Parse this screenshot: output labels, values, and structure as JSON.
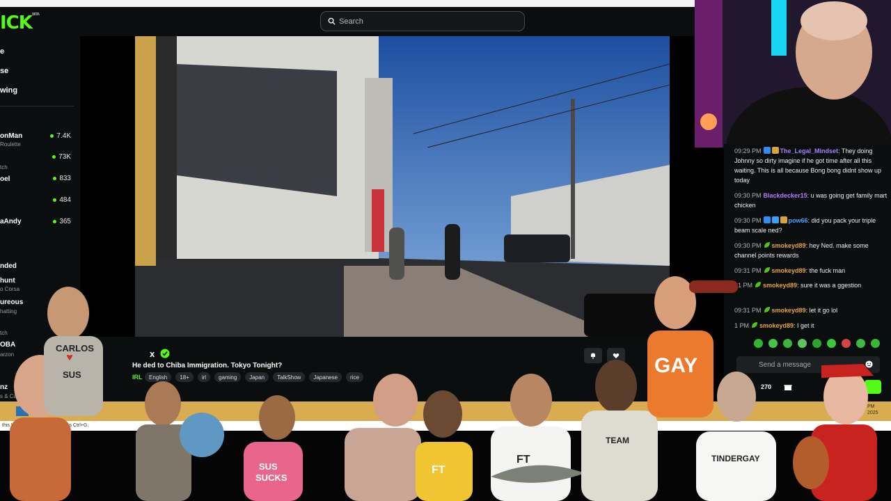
{
  "header": {
    "logo_text": "ICK",
    "logo_beta": "BETA",
    "search_placeholder": "Search"
  },
  "sidebar": {
    "nav": [
      "e",
      "se",
      "wing"
    ],
    "sections": [
      "tch",
      "nded",
      "tch"
    ],
    "channels": [
      {
        "name": "onMan",
        "category": "Roulette",
        "viewers": "7.4K"
      },
      {
        "name": "",
        "category": "",
        "viewers": "73K"
      },
      {
        "name": "oel",
        "category": "",
        "viewers": "833"
      },
      {
        "name": "",
        "category": "",
        "viewers": "484"
      },
      {
        "name": "aAndy",
        "category": "",
        "viewers": "365"
      }
    ],
    "recommended": [
      {
        "name": "hunt",
        "category": "o Corsa"
      },
      {
        "name": "ureous",
        "category": "hatting"
      }
    ],
    "bottom": [
      {
        "name": "OBA",
        "category": "arzon"
      },
      {
        "name": "nz",
        "category": "s & Cas"
      }
    ]
  },
  "stream": {
    "streamer": "x",
    "title": "He  ded to Chiba Immigration. Tokyo Tonight?",
    "category": "IRL",
    "tags": [
      "English",
      "18+",
      "irl",
      "gaming",
      "Japan",
      "TalkShow",
      "Japanese",
      "rice"
    ]
  },
  "taskbar": {
    "clock_line1": "PM",
    "clock_line2": "2025",
    "notice": "this VM, m          ointer inside or press Ctrl+G."
  },
  "chat": {
    "messages": [
      {
        "time": "09:29 PM",
        "user": "The_Legal_Mindset",
        "text": ": They doing Johnny so dirty imagine if he got time after all this waiting. This is all because Bong bong didnt show up today"
      },
      {
        "time": "09:30 PM",
        "user": "Blackdecker15",
        "text": ": u was going get family mart chicken"
      },
      {
        "time": "09:30 PM",
        "user": "pow66",
        "text": ": did you pack your triple beam scale ned?"
      },
      {
        "time": "09:30 PM",
        "user": "smokeyd89",
        "text": ": hey Ned. make some channel points rewards"
      },
      {
        "time": "09:31 PM",
        "user": "smokeyd89",
        "text": ": the fuck man"
      },
      {
        "time": "31 PM",
        "user": "smokeyd89",
        "text": ": sure it was a ggestion"
      },
      {
        "time": "09:31 PM",
        "user": "smokeyd89",
        "text": ": let it go lol"
      },
      {
        "time": "1 PM",
        "user": "smokeyd89",
        "text": ": I get it"
      }
    ],
    "input_placeholder": "Send a message",
    "points": "270"
  },
  "figurines": {
    "shirts": [
      "CARLOS",
      "SUS",
      "GAY",
      "SUS",
      "SUCKS",
      "FT",
      "FT",
      "TEAM",
      "TINDERGAY"
    ]
  },
  "colors": {
    "brand": "#53fc18",
    "taskbar": "#d9ac52",
    "background": "#0b0e0f"
  }
}
